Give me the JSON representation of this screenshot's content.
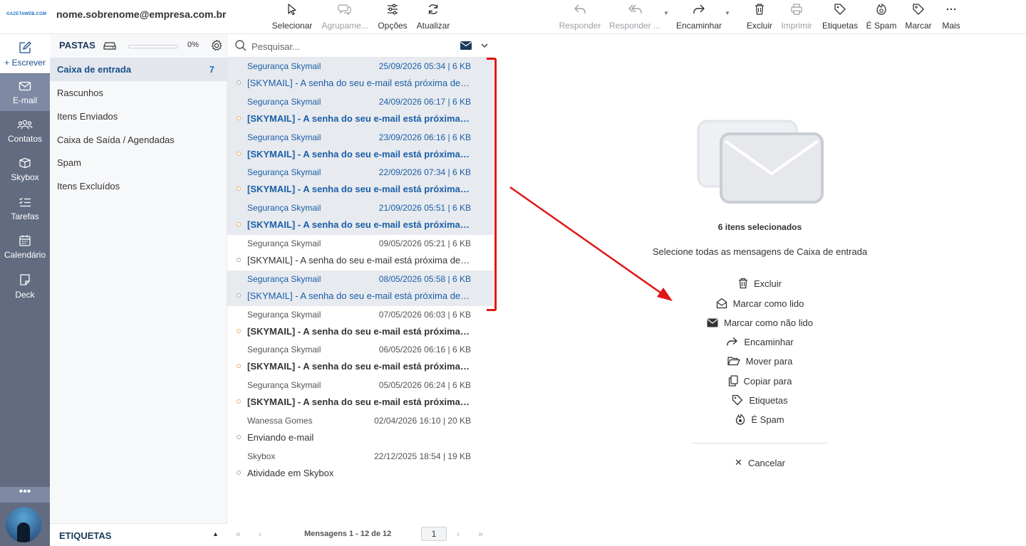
{
  "app": {
    "logo_text": "GAZETAWEB.COM",
    "account_email": "nome.sobrenome@empresa.com.br"
  },
  "toolbar": {
    "select": "Selecionar",
    "group": "Agrupame...",
    "options": "Opções",
    "refresh": "Atualizar",
    "reply": "Responder",
    "reply_all": "Responder ...",
    "forward": "Encaminhar",
    "delete": "Excluir",
    "print": "Imprimir",
    "labels": "Etiquetas",
    "spam": "É Spam",
    "mark": "Marcar",
    "more": "Mais"
  },
  "rail": {
    "compose": "+ Escrever",
    "email": "E-mail",
    "contacts": "Contatos",
    "skybox": "Skybox",
    "tasks": "Tarefas",
    "calendar": "Calendário",
    "deck": "Deck",
    "more": "•••"
  },
  "folders": {
    "title": "PASTAS",
    "quota_pct": "0%",
    "quota_fraction": 0,
    "items": [
      {
        "label": "Caixa de entrada",
        "count": "7"
      },
      {
        "label": "Rascunhos",
        "count": ""
      },
      {
        "label": "Itens Enviados",
        "count": ""
      },
      {
        "label": "Caixa de Saída / Agendadas",
        "count": ""
      },
      {
        "label": "Spam",
        "count": ""
      },
      {
        "label": "Itens Excluídos",
        "count": ""
      }
    ],
    "tags_title": "ETIQUETAS"
  },
  "search": {
    "placeholder": "Pesquisar..."
  },
  "messages": [
    {
      "from": "Segurança Skymail",
      "date": "25/09/2026 05:34 | 6 KB",
      "subject": "[SKYMAIL] - A senha do seu e-mail está próxima de expirar",
      "selected": true,
      "unread": false
    },
    {
      "from": "Segurança Skymail",
      "date": "24/09/2026 06:17 | 6 KB",
      "subject": "[SKYMAIL] - A senha do seu e-mail está próxima de expirar",
      "selected": true,
      "unread": true
    },
    {
      "from": "Segurança Skymail",
      "date": "23/09/2026 06:16 | 6 KB",
      "subject": "[SKYMAIL] - A senha do seu e-mail está próxima de expirar",
      "selected": true,
      "unread": true
    },
    {
      "from": "Segurança Skymail",
      "date": "22/09/2026 07:34 | 6 KB",
      "subject": "[SKYMAIL] - A senha do seu e-mail está próxima de expirar",
      "selected": true,
      "unread": true
    },
    {
      "from": "Segurança Skymail",
      "date": "21/09/2026 05:51 | 6 KB",
      "subject": "[SKYMAIL] - A senha do seu e-mail está próxima de expirar",
      "selected": true,
      "unread": true
    },
    {
      "from": "Segurança Skymail",
      "date": "09/05/2026 05:21 | 6 KB",
      "subject": "[SKYMAIL] - A senha do seu e-mail está próxima de expirar",
      "selected": false,
      "unread": false
    },
    {
      "from": "Segurança Skymail",
      "date": "08/05/2026 05:58 | 6 KB",
      "subject": "[SKYMAIL] - A senha do seu e-mail está próxima de expirar",
      "selected": true,
      "unread": false
    },
    {
      "from": "Segurança Skymail",
      "date": "07/05/2026 06:03 | 6 KB",
      "subject": "[SKYMAIL] - A senha do seu e-mail está próxima de expirar",
      "selected": false,
      "unread": true
    },
    {
      "from": "Segurança Skymail",
      "date": "06/05/2026 06:16 | 6 KB",
      "subject": "[SKYMAIL] - A senha do seu e-mail está próxima de expirar",
      "selected": false,
      "unread": true
    },
    {
      "from": "Segurança Skymail",
      "date": "05/05/2026 06:24 | 6 KB",
      "subject": "[SKYMAIL] - A senha do seu e-mail está próxima de expirar",
      "selected": false,
      "unread": true
    },
    {
      "from": "Wanessa Gomes",
      "date": "02/04/2026 16:10 | 20 KB",
      "subject": "Enviando e-mail",
      "selected": false,
      "unread": false
    },
    {
      "from": "Skybox",
      "date": "22/12/2025 18:54 | 19 KB",
      "subject": "Atividade em Skybox",
      "selected": false,
      "unread": false
    }
  ],
  "pager": {
    "info": "Mensagens 1 - 12 de 12",
    "page": "1"
  },
  "preview": {
    "selected_count": "6 itens selecionados",
    "select_all": "Selecione todas as mensagens de Caixa de entrada",
    "actions": [
      {
        "label": "Excluir",
        "icon": "trash-icon"
      },
      {
        "label": "Marcar como lido",
        "icon": "envelope-open-icon"
      },
      {
        "label": "Marcar como não lido",
        "icon": "envelope-icon"
      },
      {
        "label": "Encaminhar",
        "icon": "forward-icon"
      },
      {
        "label": "Mover para",
        "icon": "folder-open-icon"
      },
      {
        "label": "Copiar para",
        "icon": "copy-icon"
      },
      {
        "label": "Etiquetas",
        "icon": "tag-icon"
      },
      {
        "label": "É Spam",
        "icon": "spam-icon"
      }
    ],
    "cancel": "Cancelar"
  },
  "colors": {
    "accent": "#1b5fa8",
    "rail": "#626b80",
    "rail_active": "#7e8aa4",
    "annotation": "#e01515",
    "selected_row": "#e7eaef"
  }
}
